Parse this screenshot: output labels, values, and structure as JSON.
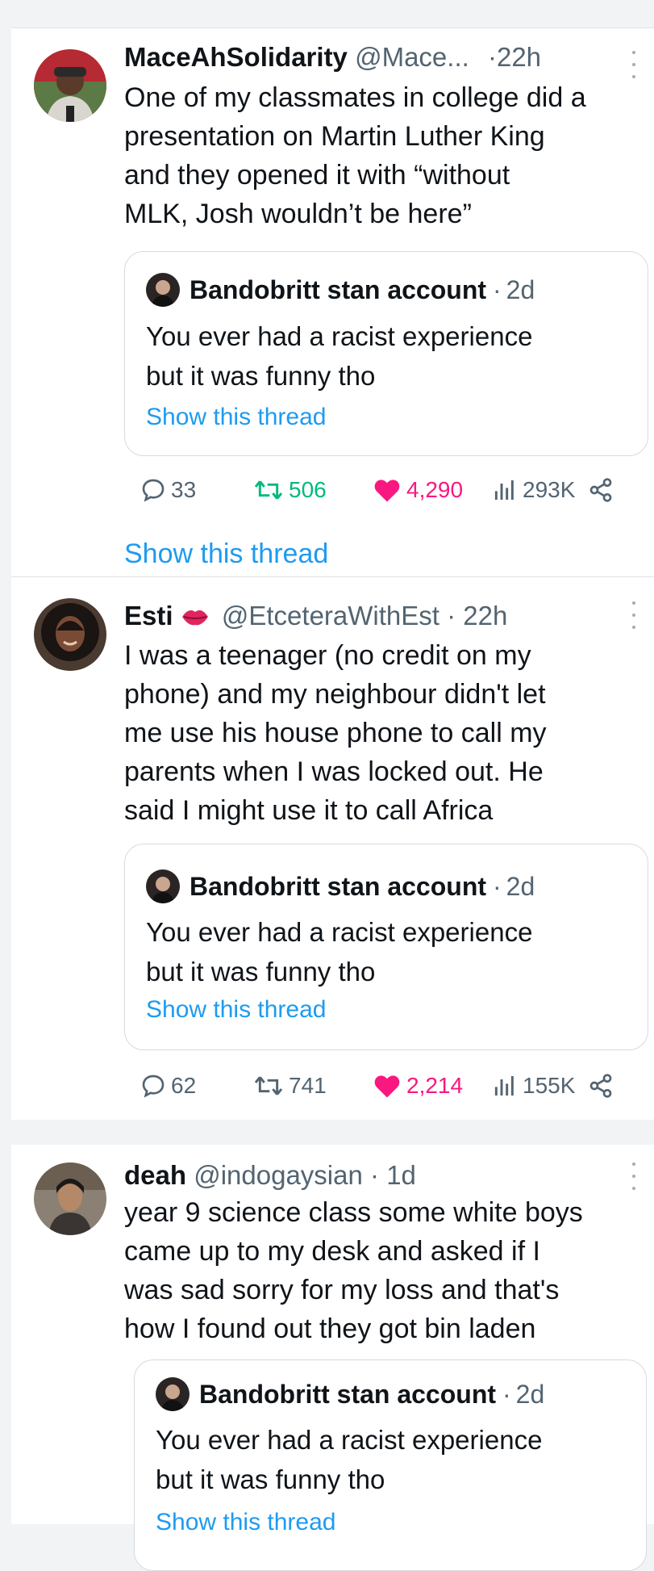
{
  "tweets": [
    {
      "name": "MaceAhSolidarity",
      "handle": "@Mace...",
      "dot": "·",
      "time": "22h",
      "lines": [
        "One of my classmates in college did a",
        "presentation on Martin Luther King",
        "and they opened it with “without",
        "MLK, Josh wouldn’t be here”"
      ],
      "quote": {
        "name": "Bandobritt stan account",
        "dot": "·",
        "time": "2d",
        "lines": [
          "You ever had a racist experience",
          "but it was funny tho"
        ],
        "link": "Show this thread"
      },
      "replies": "33",
      "retweets": "506",
      "likes": "4,290",
      "views": "293K",
      "thread_link": "Show this thread"
    },
    {
      "name": "Esti",
      "handle": "@EtceteraWithEst",
      "dot": "·",
      "time": "22h",
      "lines": [
        "I was a teenager (no credit on my",
        "phone) and my neighbour didn't let",
        "me use his house phone to call my",
        "parents when I was locked out. He",
        "said I might use it to call Africa"
      ],
      "quote": {
        "name": "Bandobritt stan account",
        "dot": "·",
        "time": "2d",
        "lines": [
          "You ever had a racist experience",
          "but it was funny tho"
        ],
        "link": "Show this thread"
      },
      "replies": "62",
      "retweets": "741",
      "likes": "2,214",
      "views": "155K"
    },
    {
      "name": "deah",
      "handle": "@indogaysian",
      "dot": "·",
      "time": "1d",
      "lines": [
        "year 9 science class some white boys",
        "came up to my desk and asked if I",
        "was sad sorry for my loss and that's",
        "how I found out they got bin laden"
      ],
      "quote": {
        "name": "Bandobritt stan account",
        "dot": "·",
        "time": "2d",
        "lines": [
          "You ever had a racist experience",
          "but it was funny tho"
        ],
        "link": "Show this thread"
      }
    }
  ],
  "icons": {
    "reply": "reply-icon",
    "retweet": "retweet-icon",
    "like": "heart-icon",
    "views": "views-icon",
    "share": "share-icon",
    "more": "more-icon",
    "emoji": "lips-emoji-icon"
  },
  "colors": {
    "link": "#1d9bf0",
    "like": "#f91880",
    "retweet": "#00ba7c",
    "muted": "#536471"
  }
}
